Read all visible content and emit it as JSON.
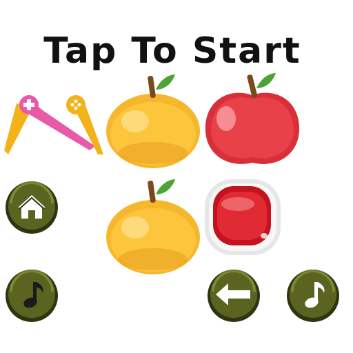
{
  "screen": {
    "title": "Tap To Start"
  },
  "colors": {
    "button_fill": "#5a6420",
    "button_rim": "#2f3510",
    "button_highlight": "#8a9a3a",
    "orange": "#f6b72d",
    "red_apple": "#e0353d",
    "pink_bar": "#e85aa8",
    "yellow_bar": "#f2b218"
  },
  "icons": {
    "home": "home-icon",
    "music_left": "music-note-icon",
    "back": "arrow-left-icon",
    "music_right": "music-note-icon",
    "controller_left": "gamepad-plus-icon",
    "controller_right": "gamepad-dpad-icon"
  }
}
